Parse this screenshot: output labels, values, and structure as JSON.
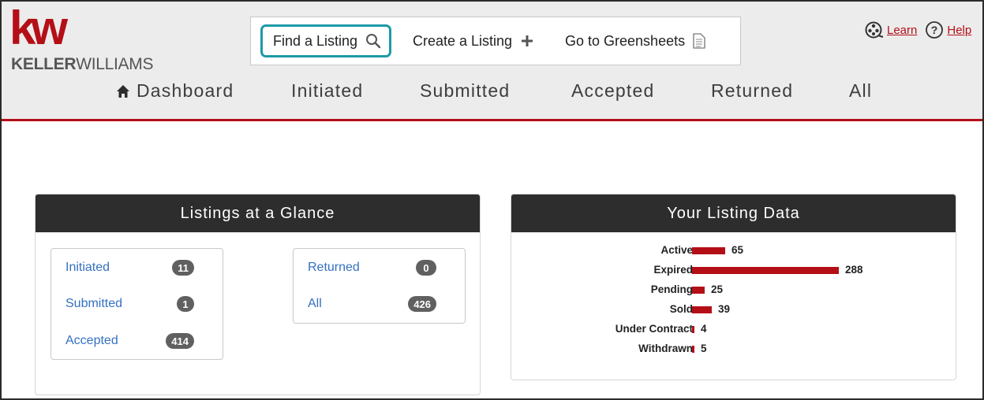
{
  "brand": {
    "logo_mark": "kw",
    "logo_text_bold": "KELLER",
    "logo_text_light": "WILLIAMS",
    "accent_color": "#b40f17",
    "highlight_color": "#1d9aa8"
  },
  "actions": {
    "find_label": "Find a Listing",
    "find_icon": "search-icon",
    "create_label": "Create a Listing",
    "create_icon": "plus-icon",
    "greensheets_label": "Go to Greensheets",
    "greensheets_icon": "document-icon"
  },
  "help": {
    "learn_label": "Learn",
    "learn_icon": "film-reel-icon",
    "help_label": "Help",
    "help_icon": "question-circle-icon"
  },
  "nav": {
    "dashboard": "Dashboard",
    "initiated": "Initiated",
    "submitted": "Submitted",
    "accepted": "Accepted",
    "returned": "Returned",
    "all": "All"
  },
  "glance": {
    "title": "Listings at a Glance",
    "initiated_label": "Initiated",
    "initiated_count": "11",
    "submitted_label": "Submitted",
    "submitted_count": "1",
    "accepted_label": "Accepted",
    "accepted_count": "414",
    "returned_label": "Returned",
    "returned_count": "0",
    "all_label": "All",
    "all_count": "426"
  },
  "listing_data": {
    "title": "Your Listing Data"
  },
  "chart_data": {
    "type": "bar",
    "orientation": "horizontal",
    "title": "Your Listing Data",
    "categories": [
      "Active",
      "Expired",
      "Pending",
      "Sold",
      "Under Contract",
      "Withdrawn"
    ],
    "values": [
      65,
      288,
      25,
      39,
      4,
      5
    ],
    "xlabel": "",
    "ylabel": "",
    "grid": false,
    "bar_color": "#b40f17"
  }
}
